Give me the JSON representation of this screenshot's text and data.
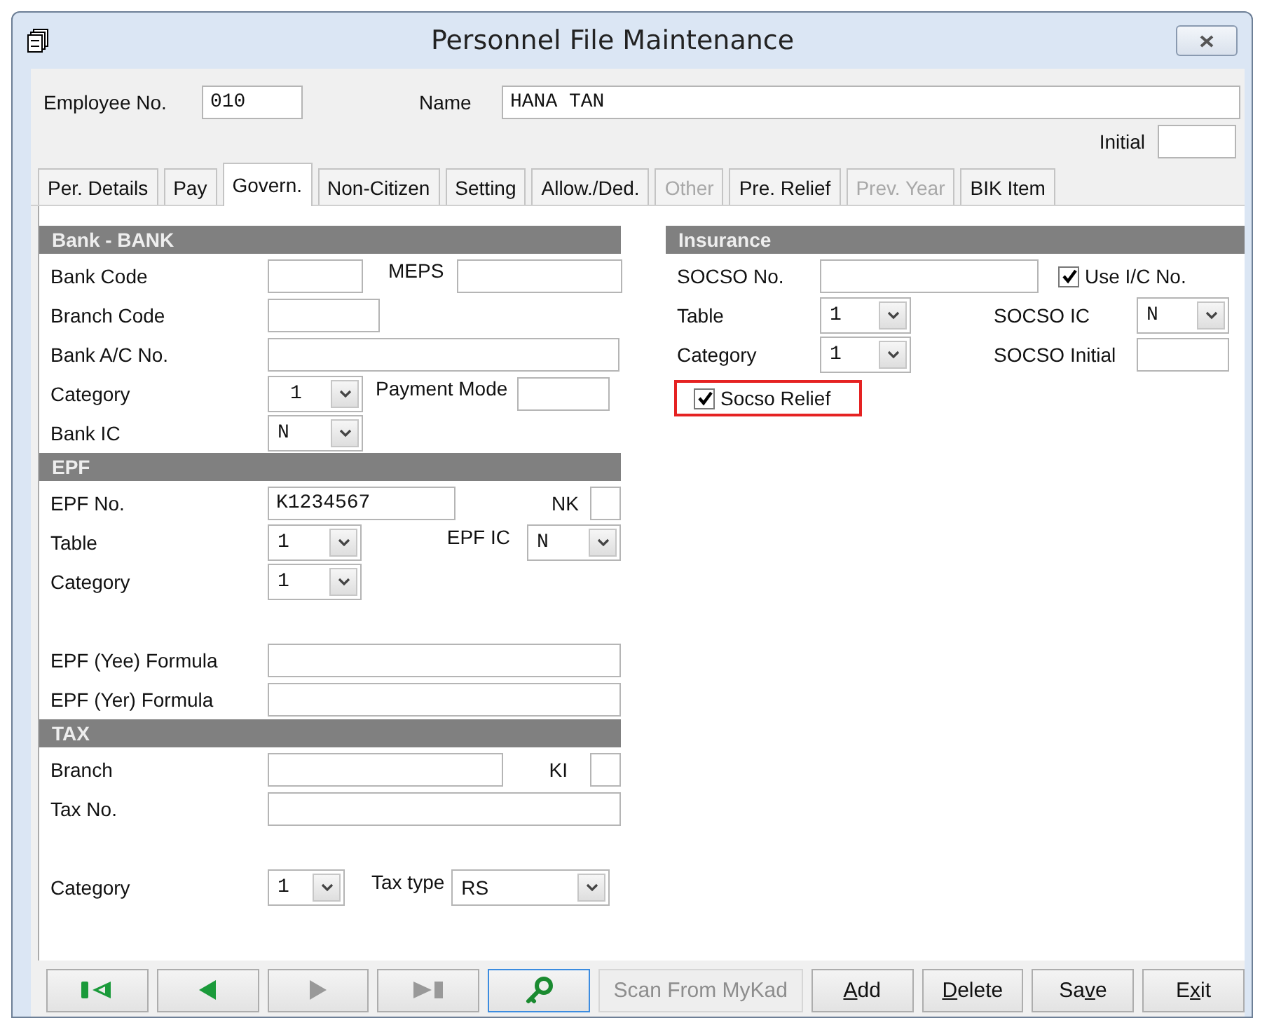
{
  "window": {
    "title": "Personnel File Maintenance"
  },
  "header": {
    "employee_no": {
      "label": "Employee No.",
      "value": "010"
    },
    "name": {
      "label": "Name",
      "value": "HANA TAN"
    },
    "initial": {
      "label": "Initial"
    }
  },
  "tabs": [
    {
      "label": "Per. Details",
      "selected": false,
      "disabled": false
    },
    {
      "label": "Pay",
      "selected": false,
      "disabled": false
    },
    {
      "label": "Govern.",
      "selected": true,
      "disabled": false
    },
    {
      "label": "Non-Citizen",
      "selected": false,
      "disabled": false
    },
    {
      "label": "Setting",
      "selected": false,
      "disabled": false
    },
    {
      "label": "Allow./Ded.",
      "selected": false,
      "disabled": false
    },
    {
      "label": "Other",
      "selected": false,
      "disabled": true
    },
    {
      "label": "Pre. Relief",
      "selected": false,
      "disabled": false
    },
    {
      "label": "Prev. Year",
      "selected": false,
      "disabled": true
    },
    {
      "label": "BIK Item",
      "selected": false,
      "disabled": false
    }
  ],
  "bank": {
    "title": "Bank - BANK",
    "bank_code": {
      "label": "Bank Code"
    },
    "meps": {
      "label": "MEPS"
    },
    "branch_code": {
      "label": "Branch Code"
    },
    "account_no": {
      "label": "Bank A/C No."
    },
    "category": {
      "label": "Category",
      "value": "1"
    },
    "payment_mode": {
      "label": "Payment Mode"
    },
    "bank_ic": {
      "label": "Bank IC",
      "value": "N"
    }
  },
  "epf": {
    "title": "EPF",
    "epf_no": {
      "label": "EPF No.",
      "value": "K1234567"
    },
    "nk": {
      "label": "NK"
    },
    "table": {
      "label": "Table",
      "value": "1"
    },
    "epf_ic": {
      "label": "EPF IC",
      "value": "N"
    },
    "category": {
      "label": "Category",
      "value": "1"
    },
    "yee_formula": {
      "label": "EPF (Yee) Formula"
    },
    "yer_formula": {
      "label": "EPF (Yer) Formula"
    }
  },
  "tax": {
    "title": "TAX",
    "branch": {
      "label": "Branch"
    },
    "ki": {
      "label": "KI"
    },
    "tax_no": {
      "label": "Tax No."
    },
    "category": {
      "label": "Category",
      "value": "1"
    },
    "tax_type": {
      "label": "Tax type",
      "value": "RS"
    }
  },
  "insurance": {
    "title": "Insurance",
    "socso_no": {
      "label": "SOCSO No."
    },
    "use_ic": {
      "label": "Use I/C No.",
      "checked": true
    },
    "table": {
      "label": "Table",
      "value": "1"
    },
    "socso_ic": {
      "label": "SOCSO IC",
      "value": "N"
    },
    "category": {
      "label": "Category",
      "value": "1"
    },
    "socso_initial": {
      "label": "SOCSO Initial"
    },
    "socso_relief": {
      "label": "Socso Relief",
      "checked": true,
      "highlighted": true
    }
  },
  "nav_buttons": [
    {
      "kind": "first",
      "disabled": false,
      "focused": false
    },
    {
      "kind": "previous",
      "disabled": false,
      "focused": false
    },
    {
      "kind": "next",
      "disabled": true,
      "focused": false
    },
    {
      "kind": "last",
      "disabled": true,
      "focused": false
    },
    {
      "kind": "find",
      "disabled": false,
      "focused": true
    }
  ],
  "actions": [
    {
      "pre": "Scan From MyKad",
      "disabled": true
    },
    {
      "key": "A",
      "post": "dd",
      "disabled": false
    },
    {
      "key": "D",
      "post": "elete",
      "disabled": false
    },
    {
      "pre": "Sa",
      "key": "v",
      "post": "e",
      "disabled": false
    },
    {
      "pre": "E",
      "key": "x",
      "post": "it",
      "disabled": false
    }
  ]
}
